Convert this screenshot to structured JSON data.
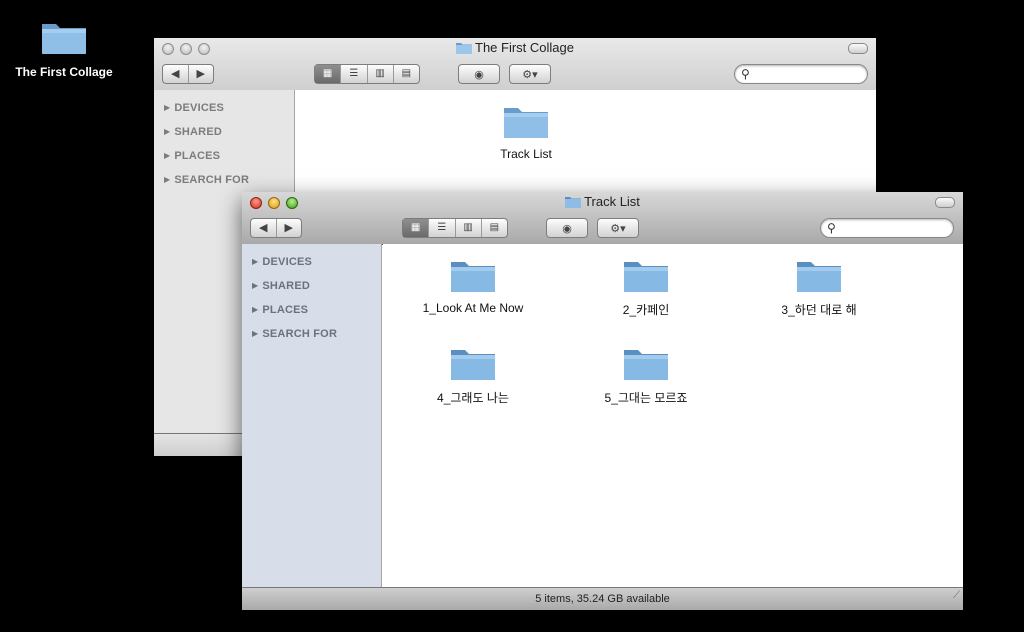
{
  "desktop": {
    "folder_label": "The First Collage"
  },
  "back_window": {
    "title": "The First Collage",
    "sidebar": [
      "DEVICES",
      "SHARED",
      "PLACES",
      "SEARCH FOR"
    ],
    "items": [
      "Track List"
    ]
  },
  "front_window": {
    "title": "Track List",
    "sidebar": [
      "DEVICES",
      "SHARED",
      "PLACES",
      "SEARCH FOR"
    ],
    "items": [
      "1_Look At Me Now",
      "2_카페인",
      "3_하던 대로 해",
      "4_그래도 나는",
      "5_그대는 모르죠"
    ],
    "status": "5 items, 35.24 GB available"
  },
  "toolbar": {
    "back_icon": "◀",
    "forward_icon": "▶",
    "view_icons": [
      "▦",
      "☰",
      "▥",
      "▤"
    ],
    "eye_icon": "◉",
    "gear_icon": "⚙▾",
    "search_icon": "⚲",
    "search_placeholder": ""
  },
  "colors": {
    "folder": "#7fb3dd",
    "sidebar_front": "#d7deea"
  }
}
